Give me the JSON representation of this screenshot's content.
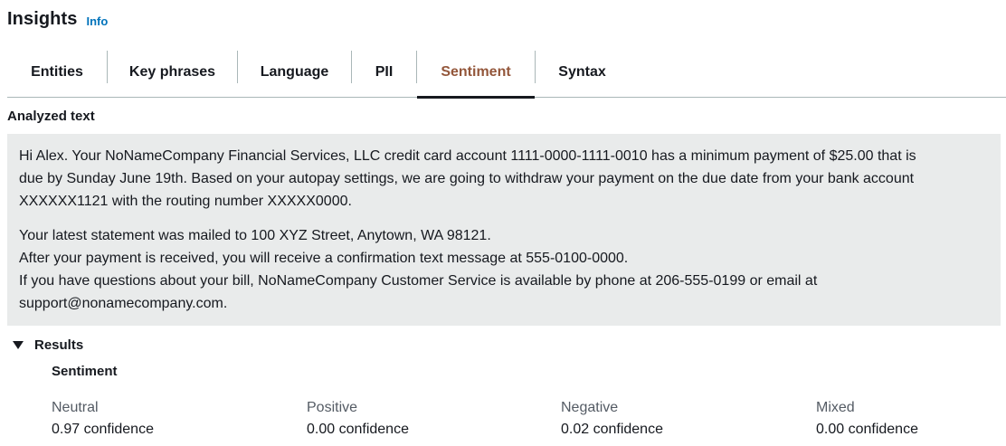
{
  "header": {
    "title": "Insights",
    "info_label": "Info"
  },
  "tabs": [
    {
      "label": "Entities",
      "active": false
    },
    {
      "label": "Key phrases",
      "active": false
    },
    {
      "label": "Language",
      "active": false
    },
    {
      "label": "PII",
      "active": false
    },
    {
      "label": "Sentiment",
      "active": true
    },
    {
      "label": "Syntax",
      "active": false
    }
  ],
  "analyzed": {
    "label": "Analyzed text",
    "paragraph1": [
      "Hi Alex. Your NoNameCompany Financial Services, LLC credit card account 1111-0000-1111-0010 has a minimum payment of $25.00 that is",
      "due by Sunday June 19th. Based on your autopay settings, we  are going to withdraw your payment on the due date from your bank account",
      "XXXXXX1121 with the routing number  XXXXX0000."
    ],
    "paragraph2": [
      "Your latest statement was mailed to 100 XYZ Street, Anytown, WA 98121.",
      "After your payment is received, you will receive a confirmation text message at 555-0100-0000.",
      "If you have questions about your bill, NoNameCompany Customer Service is available by phone at 206-555-0199 or email at",
      "support@nonamecompany.com."
    ]
  },
  "results": {
    "toggle_label": "Results",
    "expanded": true,
    "sentiment_heading": "Sentiment",
    "scores": [
      {
        "label": "Neutral",
        "value": "0.97 confidence"
      },
      {
        "label": "Positive",
        "value": "0.00 confidence"
      },
      {
        "label": "Negative",
        "value": "0.02 confidence"
      },
      {
        "label": "Mixed",
        "value": "0.00 confidence"
      }
    ]
  },
  "colors": {
    "accent_active_tab": "#93563a",
    "link": "#0073bb",
    "text_box_bg": "#e9ebeb"
  },
  "icons": {
    "results_toggle": "caret-down-icon"
  }
}
